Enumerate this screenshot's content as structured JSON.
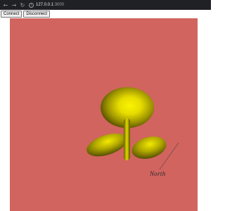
{
  "browser": {
    "back_icon": "arrow-left-icon",
    "forward_icon": "arrow-right-icon",
    "reload_icon": "reload-icon",
    "info_icon": "info-icon",
    "url_host": "127.0.0.1",
    "url_port": ":3000"
  },
  "toolbar": {
    "connect_label": "Connect",
    "disconnect_label": "Disconnect"
  },
  "scene": {
    "background_color": "#d1645f",
    "object_color": "#e8e000",
    "label": "North"
  }
}
